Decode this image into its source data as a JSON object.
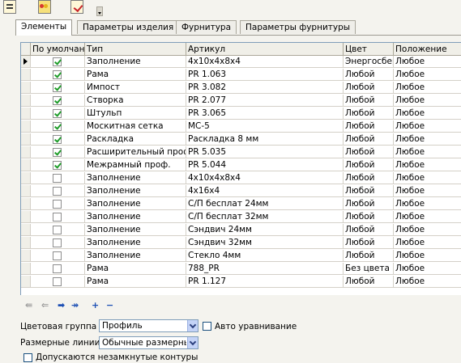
{
  "toolbar": {
    "icons": [
      "list-icon",
      "traffic-light-icon",
      "checklist-icon",
      "dropdown-arrow-icon"
    ]
  },
  "tabs": [
    {
      "label": "Элементы",
      "active": true
    },
    {
      "label": "Параметры изделия",
      "active": false
    },
    {
      "label": "Фурнитура",
      "active": false
    },
    {
      "label": "Параметры фурнитуры",
      "active": false
    }
  ],
  "grid": {
    "columns": [
      "По умолчанию",
      "Тип",
      "Артикул",
      "Цвет",
      "Положение"
    ],
    "rows": [
      {
        "checked": true,
        "type": "Заполнение",
        "article": "4x10x4x8x4",
        "color": "Энергосбер",
        "position": "Любое",
        "current": true
      },
      {
        "checked": true,
        "type": "Рама",
        "article": "PR 1.063",
        "color": "Любой",
        "position": "Любое"
      },
      {
        "checked": true,
        "type": "Импост",
        "article": "PR 3.082",
        "color": "Любой",
        "position": "Любое"
      },
      {
        "checked": true,
        "type": "Створка",
        "article": "PR 2.077",
        "color": "Любой",
        "position": "Любое"
      },
      {
        "checked": true,
        "type": "Штульп",
        "article": "PR 3.065",
        "color": "Любой",
        "position": "Любое"
      },
      {
        "checked": true,
        "type": "Москитная сетка",
        "article": "МС-5",
        "color": "Любой",
        "position": "Любое"
      },
      {
        "checked": true,
        "type": "Раскладка",
        "article": "Раскладка 8 мм",
        "color": "Любой",
        "position": "Любое"
      },
      {
        "checked": true,
        "type": "Расширительный проф.",
        "article": "PR 5.035",
        "color": "Любой",
        "position": "Любое"
      },
      {
        "checked": true,
        "type": "Межрамный проф.",
        "article": "PR 5.044",
        "color": "Любой",
        "position": "Любое"
      },
      {
        "checked": false,
        "type": "Заполнение",
        "article": "4x10x4x8x4",
        "color": "Любой",
        "position": "Любое"
      },
      {
        "checked": false,
        "type": "Заполнение",
        "article": "4x16x4",
        "color": "Любой",
        "position": "Любое"
      },
      {
        "checked": false,
        "type": "Заполнение",
        "article": "С/П бесплат 24мм",
        "color": "Любой",
        "position": "Любое"
      },
      {
        "checked": false,
        "type": "Заполнение",
        "article": "С/П бесплат 32мм",
        "color": "Любой",
        "position": "Любое"
      },
      {
        "checked": false,
        "type": "Заполнение",
        "article": "Сэндвич 24мм",
        "color": "Любой",
        "position": "Любое"
      },
      {
        "checked": false,
        "type": "Заполнение",
        "article": "Сэндвич 32мм",
        "color": "Любой",
        "position": "Любое"
      },
      {
        "checked": false,
        "type": "Заполнение",
        "article": "Стекло 4мм",
        "color": "Любой",
        "position": "Любое"
      },
      {
        "checked": false,
        "type": "Рама",
        "article": "788_PR",
        "color": "Без цвета",
        "position": "Любое"
      },
      {
        "checked": false,
        "type": "Рама",
        "article": "PR 1.127",
        "color": "Любой",
        "position": "Любое"
      }
    ]
  },
  "navigator": {
    "buttons": [
      {
        "name": "first-record-icon",
        "glyph": "⇚",
        "enabled": false
      },
      {
        "name": "prev-record-icon",
        "glyph": "⇐",
        "enabled": false
      },
      {
        "name": "next-record-icon",
        "glyph": "➡",
        "enabled": true
      },
      {
        "name": "last-record-icon",
        "glyph": "↠",
        "enabled": true
      },
      {
        "name": "add-record-icon",
        "glyph": "+",
        "enabled": true
      },
      {
        "name": "delete-record-icon",
        "glyph": "−",
        "enabled": true
      }
    ]
  },
  "form": {
    "color_group_label": "Цветовая группа",
    "color_group_value": "Профиль",
    "auto_align_label": "Авто уравнивание",
    "auto_align_checked": false,
    "dim_lines_label": "Размерные линии",
    "dim_lines_value": "Обычные размерные",
    "open_contours_label": "Допускаются незамкнутые контуры",
    "open_contours_checked": false
  }
}
